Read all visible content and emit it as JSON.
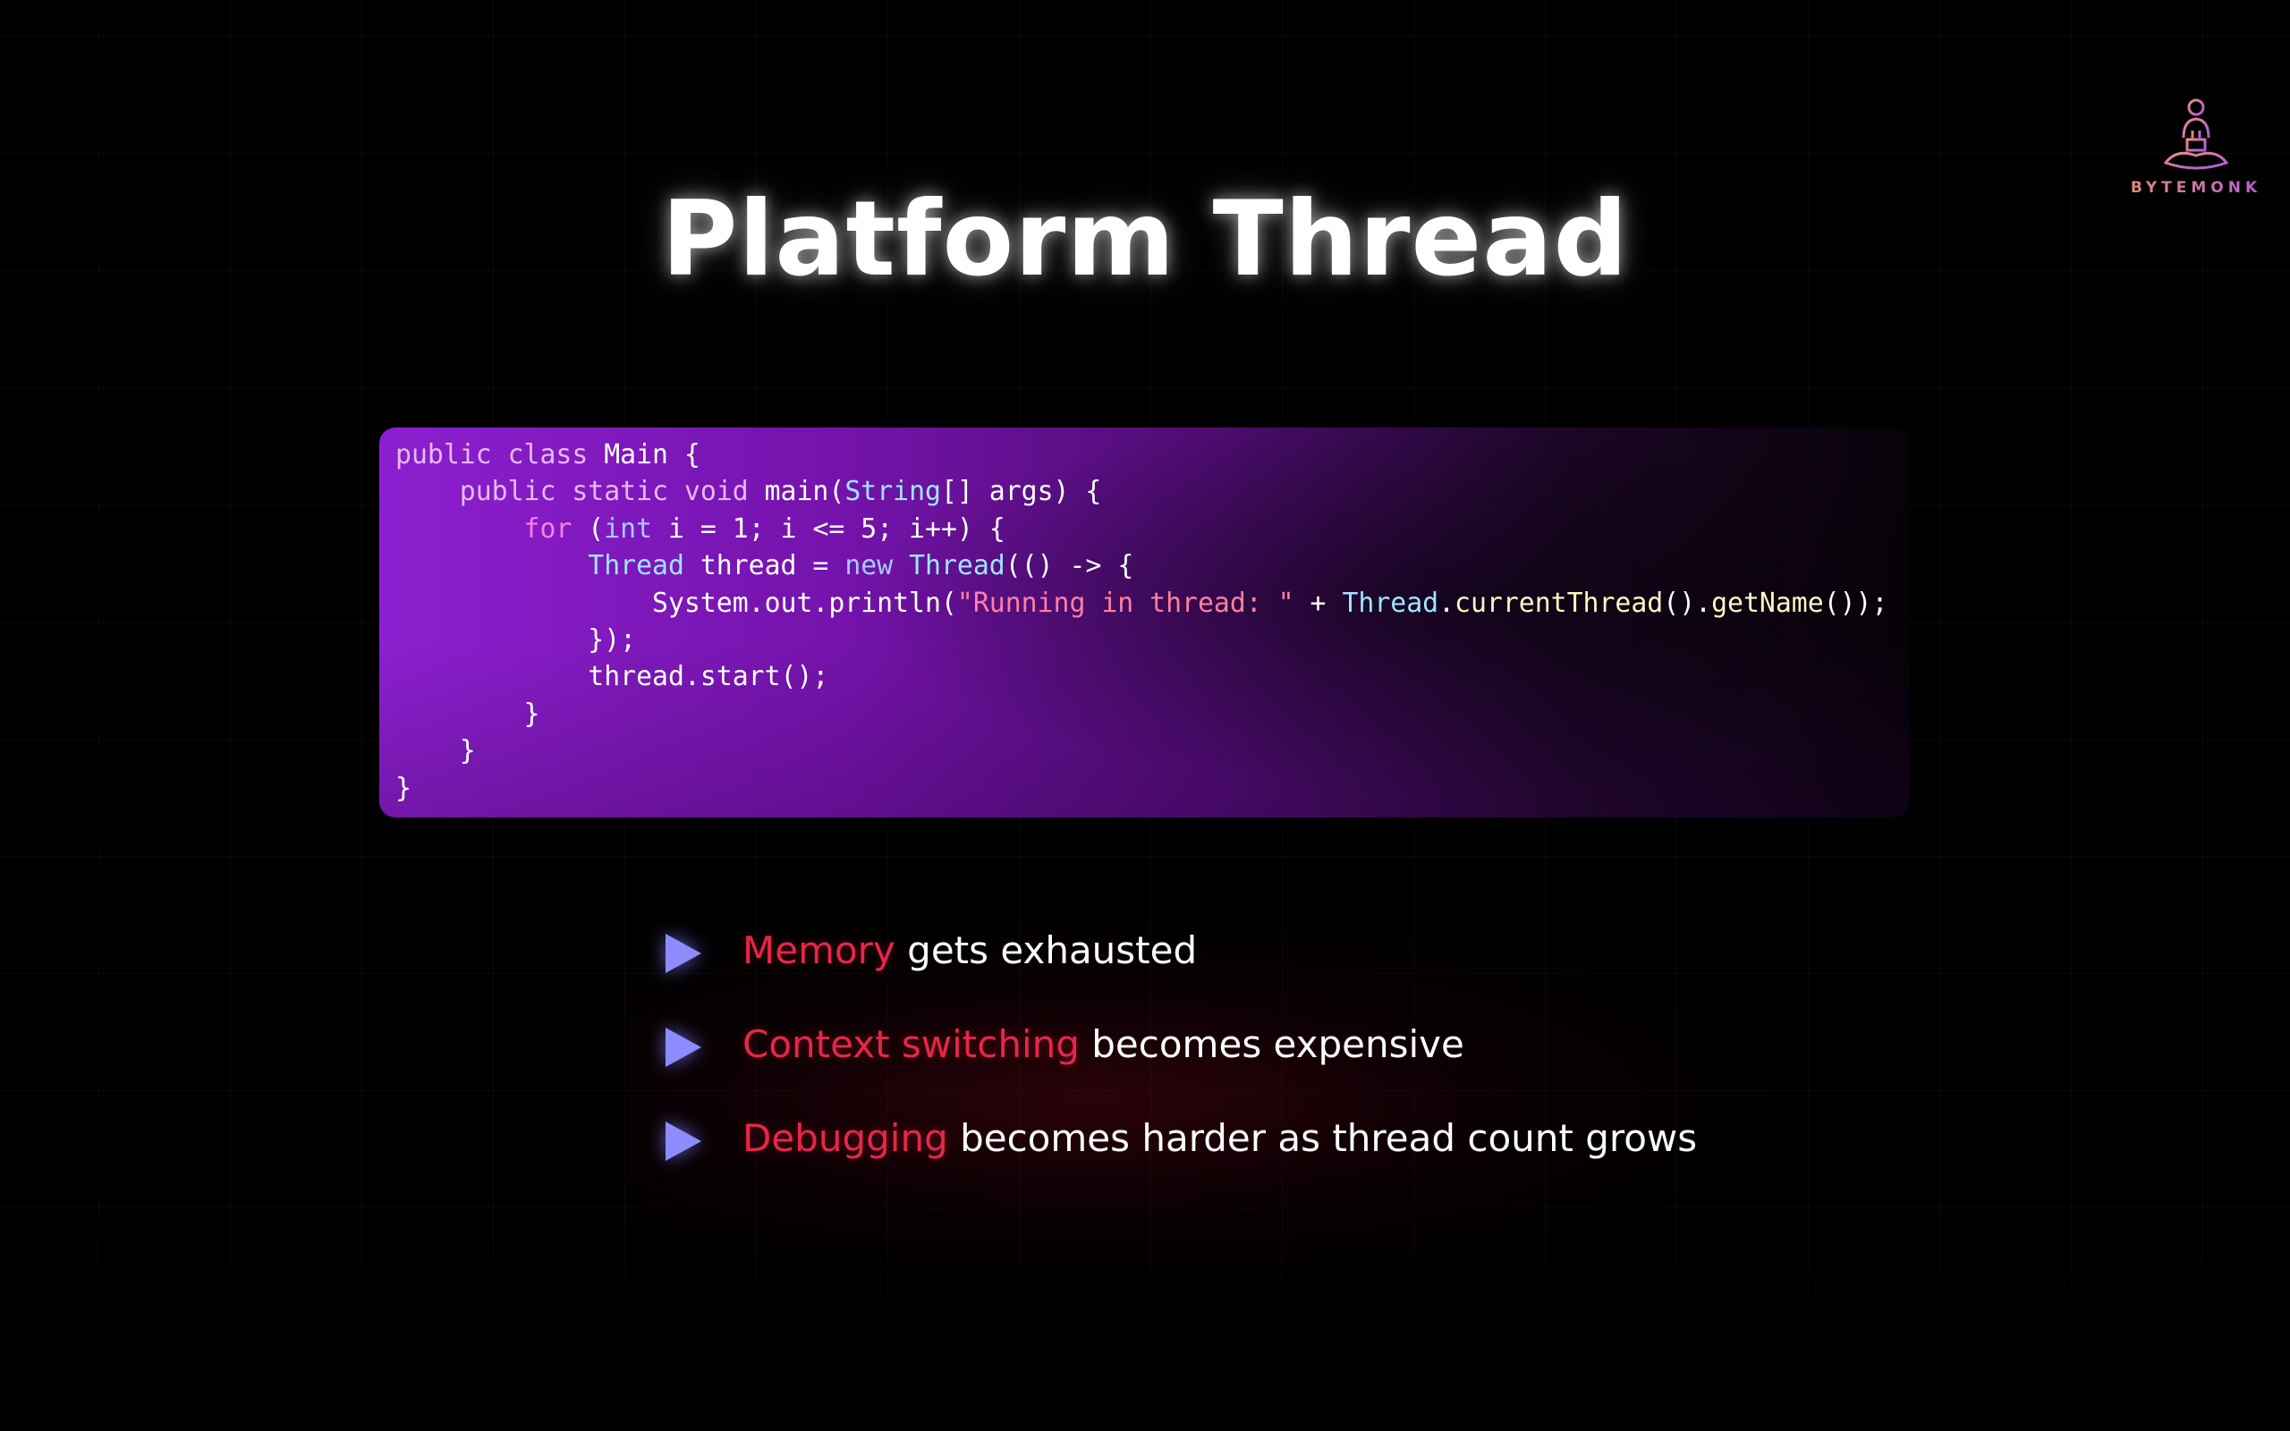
{
  "slide": {
    "title": "Platform Thread",
    "logo_text": "BYTEMONK"
  },
  "code": {
    "language": "java",
    "lines": [
      [
        {
          "t": "public class ",
          "c": "kw"
        },
        {
          "t": "Main {",
          "c": "pl"
        }
      ],
      [
        {
          "t": "    public static void ",
          "c": "kw"
        },
        {
          "t": "main(",
          "c": "pl"
        },
        {
          "t": "String",
          "c": "ty"
        },
        {
          "t": "[] args) {",
          "c": "pl"
        }
      ],
      [
        {
          "t": "        ",
          "c": "pl"
        },
        {
          "t": "for",
          "c": "kwp"
        },
        {
          "t": " (",
          "c": "pl"
        },
        {
          "t": "int",
          "c": "kw2"
        },
        {
          "t": " i = 1; i <= 5; i++) {",
          "c": "pl"
        }
      ],
      [
        {
          "t": "            ",
          "c": "pl"
        },
        {
          "t": "Thread",
          "c": "ty"
        },
        {
          "t": " thread = ",
          "c": "pl"
        },
        {
          "t": "new",
          "c": "kw2"
        },
        {
          "t": " ",
          "c": "pl"
        },
        {
          "t": "Thread",
          "c": "ty"
        },
        {
          "t": "(() -> {",
          "c": "pl"
        }
      ],
      [
        {
          "t": "                System.out.println(",
          "c": "pl"
        },
        {
          "t": "\"Running in thread: \"",
          "c": "str"
        },
        {
          "t": " + ",
          "c": "pl"
        },
        {
          "t": "Thread",
          "c": "ty"
        },
        {
          "t": ".",
          "c": "pl"
        },
        {
          "t": "currentThread",
          "c": "fn"
        },
        {
          "t": "().",
          "c": "pl"
        },
        {
          "t": "getName",
          "c": "fn"
        },
        {
          "t": "());",
          "c": "pl"
        }
      ],
      [
        {
          "t": "            });",
          "c": "pl"
        }
      ],
      [
        {
          "t": "            thread.start();",
          "c": "pl"
        }
      ],
      [
        {
          "t": "        }",
          "c": "pl"
        }
      ],
      [
        {
          "t": "    }",
          "c": "pl"
        }
      ],
      [
        {
          "t": "}",
          "c": "pl"
        }
      ]
    ]
  },
  "bullets": [
    {
      "highlight": "Memory",
      "rest": " gets exhausted"
    },
    {
      "highlight": "Context switching",
      "rest": " becomes expensive"
    },
    {
      "highlight": "Debugging",
      "rest": " becomes harder as thread count grows"
    }
  ],
  "colors": {
    "background": "#000000",
    "highlight": "#e62648",
    "bullet_arrow": "#8c8cff",
    "code_panel_start": "#8c1fcf"
  },
  "icons": {
    "logo": "meditating-monk-icon",
    "bullet": "play-triangle-icon"
  }
}
